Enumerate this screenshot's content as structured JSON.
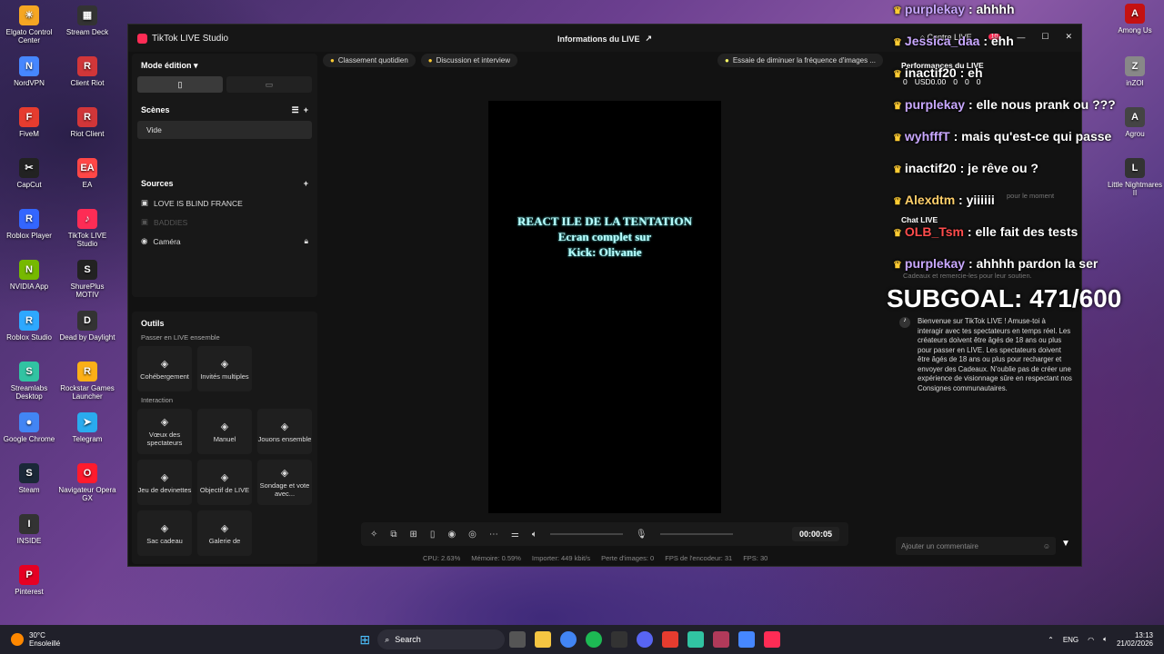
{
  "desktop_icons_left": [
    {
      "label": "Elgato Control Center",
      "color": "#f5a623",
      "glyph": "☀"
    },
    {
      "label": "NordVPN",
      "color": "#4687ff",
      "glyph": "N"
    },
    {
      "label": "FiveM",
      "color": "#e63c2f",
      "glyph": "F"
    },
    {
      "label": "CapCut",
      "color": "#222",
      "glyph": "✂"
    },
    {
      "label": "Roblox Player",
      "color": "#3366ff",
      "glyph": "R"
    },
    {
      "label": "NVIDIA App",
      "color": "#76b900",
      "glyph": "N"
    },
    {
      "label": "Roblox Studio",
      "color": "#2ea8ff",
      "glyph": "R"
    },
    {
      "label": "Streamlabs Desktop",
      "color": "#31c3a2",
      "glyph": "S"
    },
    {
      "label": "Google Chrome",
      "color": "#4285f4",
      "glyph": "●"
    },
    {
      "label": "Steam",
      "color": "#1b2838",
      "glyph": "S"
    },
    {
      "label": "INSIDE",
      "color": "#333",
      "glyph": "I"
    },
    {
      "label": "Pinterest",
      "color": "#e60023",
      "glyph": "P"
    }
  ],
  "desktop_icons_col2": [
    {
      "label": "Stream Deck",
      "color": "#333",
      "glyph": "▦"
    },
    {
      "label": "Client Riot",
      "color": "#d13639",
      "glyph": "R"
    },
    {
      "label": "Riot Client",
      "color": "#d13639",
      "glyph": "R"
    },
    {
      "label": "EA",
      "color": "#ff4747",
      "glyph": "EA"
    },
    {
      "label": "TikTok LIVE Studio",
      "color": "#fe2c55",
      "glyph": "♪"
    },
    {
      "label": "ShurePlus MOTIV",
      "color": "#222",
      "glyph": "S"
    },
    {
      "label": "Dead by Daylight",
      "color": "#333",
      "glyph": "D"
    },
    {
      "label": "Rockstar Games Launcher",
      "color": "#fcaf17",
      "glyph": "R"
    },
    {
      "label": "Telegram",
      "color": "#2aabee",
      "glyph": "➤"
    },
    {
      "label": "Navigateur Opera GX",
      "color": "#ff1b2d",
      "glyph": "O"
    }
  ],
  "desktop_icons_right": [
    {
      "label": "Among Us",
      "color": "#c51111",
      "glyph": "A"
    },
    {
      "label": "inZOI",
      "color": "#888",
      "glyph": "Z"
    },
    {
      "label": "Agrou",
      "color": "#444",
      "glyph": "A"
    },
    {
      "label": "Little Nightmares II",
      "color": "#333",
      "glyph": "L"
    }
  ],
  "window": {
    "app_title": "TikTok LIVE Studio",
    "center_title": "Informations du LIVE",
    "centre_live": "Centre LIVE",
    "notif_count": "10"
  },
  "left_panel": {
    "mode": "Mode édition ▾",
    "scenes_title": "Scènes",
    "scene_item": "Vide",
    "sources_title": "Sources",
    "sources": [
      "LOVE IS BLIND FRANCE",
      "BADDIES",
      "Caméra"
    ],
    "tools_title": "Outils",
    "group1": "Passer en LIVE ensemble",
    "tools1": [
      "Cohébergement",
      "Invités multiples"
    ],
    "group2": "Interaction",
    "tools2": [
      "Vœux des spectateurs",
      "Manuel",
      "Jouons ensemble",
      "Jeu de devinettes",
      "Objectif de LIVE",
      "Sondage et vote avec...",
      "Sac cadeau",
      "Galerie de"
    ]
  },
  "chips": [
    "Classement quotidien",
    "Discussion et interview"
  ],
  "tip": "Essaie de diminuer la fréquence d'images ...",
  "preview_text": [
    "REACT ILE DE LA TENTATION",
    "Ecran complet sur",
    "Kick: Olivanie"
  ],
  "timer": "00:00:05",
  "stats": [
    "CPU: 2.63%",
    "Mémoire: 0.59%",
    "Importer: 449 kbit/s",
    "Perte d'images: 0",
    "FPS de l'encodeur: 31",
    "FPS: 30"
  ],
  "right_panel": {
    "perf_title": "Performances du LIVE",
    "perf_values": [
      "0",
      "USD0.00",
      "0",
      "0",
      "0"
    ],
    "rank_hint": "pour le moment",
    "chat_title": "Chat LIVE",
    "gift_hint": "Cadeaux et remercie-les pour leur soutien.",
    "welcome": "Bienvenue sur TikTok LIVE ! Amuse-toi à interagir avec tes spectateurs en temps réel. Les créateurs doivent être âgés de 18 ans ou plus pour passer en LIVE. Les spectateurs doivent être âgés de 18 ans ou plus pour recharger et envoyer des Cadeaux. N'oublie pas de créer une expérience de visionnage sûre en respectant nos Consignes communautaires.",
    "comment_placeholder": "Ajouter un commentaire"
  },
  "chat_overlay": [
    {
      "user": "purplekay",
      "msg": "ahhhh",
      "color": "#c9a8ff"
    },
    {
      "user": "Jessica_daa",
      "msg": "ehh",
      "color": "#c9a8ff"
    },
    {
      "user": "inactif20",
      "msg": "eh",
      "color": "#fff"
    },
    {
      "user": "purplekay",
      "msg": "elle nous prank ou ???",
      "color": "#c9a8ff"
    },
    {
      "user": "wyhfffT",
      "msg": "mais qu'est-ce qui passe",
      "color": "#c9a8ff"
    },
    {
      "user": "inactif20",
      "msg": "je rêve ou ?",
      "color": "#fff"
    },
    {
      "user": "Alexdtm",
      "msg": "yiiiiii",
      "color": "#ffcf6a"
    },
    {
      "user": "OLB_Tsm",
      "msg": "elle fait des tests",
      "color": "#ff4d4d"
    },
    {
      "user": "purplekay",
      "msg": "ahhhh pardon la ser",
      "color": "#c9a8ff"
    }
  ],
  "subgoal": "SUBGOAL: 471/600",
  "taskbar": {
    "weather_temp": "30°C",
    "weather_desc": "Ensoleillé",
    "search": "Search",
    "lang": "ENG",
    "time": "13:13",
    "date": "21/02/2026"
  }
}
